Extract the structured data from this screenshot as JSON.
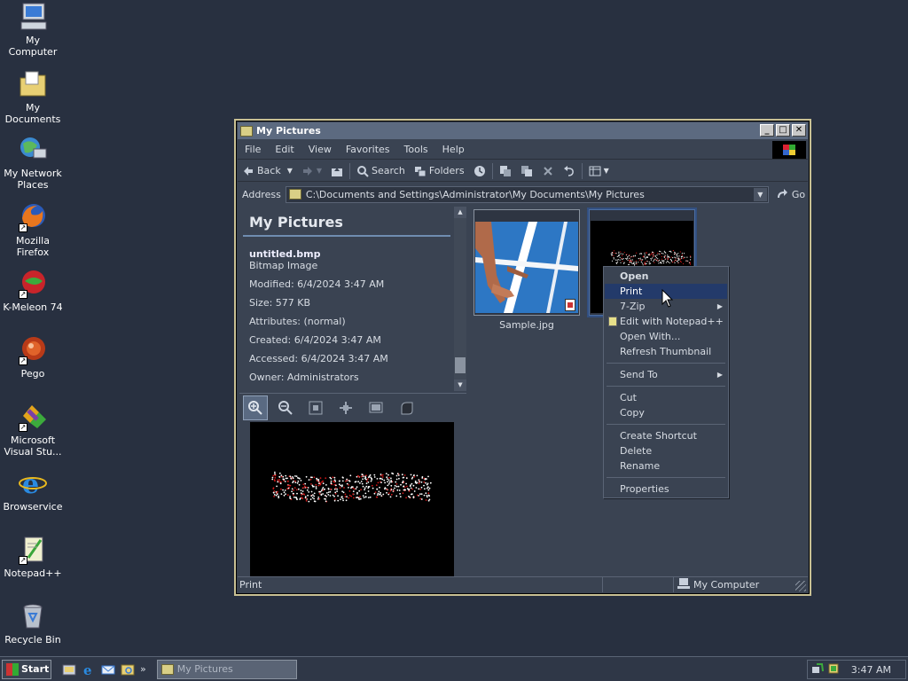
{
  "desktop": {
    "icons": [
      {
        "label": "My Computer",
        "icon": "my-computer-icon"
      },
      {
        "label": "My Documents",
        "icon": "my-documents-icon"
      },
      {
        "label": "My Network Places",
        "icon": "network-places-icon"
      },
      {
        "label": "Mozilla Firefox",
        "icon": "firefox-icon"
      },
      {
        "label": "K-Meleon 74",
        "icon": "kmeleon-icon"
      },
      {
        "label": "Pego",
        "icon": "pego-icon"
      },
      {
        "label": "Microsoft Visual Stu...",
        "icon": "visual-studio-icon"
      },
      {
        "label": "Browservice",
        "icon": "internet-explorer-icon"
      },
      {
        "label": "Notepad++",
        "icon": "notepadpp-icon"
      },
      {
        "label": "Recycle Bin",
        "icon": "recycle-bin-icon"
      }
    ]
  },
  "window": {
    "title": "My Pictures",
    "controls": {
      "minimize": "_",
      "maximize": "□",
      "close": "✕"
    },
    "menu": [
      "File",
      "Edit",
      "View",
      "Favorites",
      "Tools",
      "Help"
    ],
    "toolbar": {
      "back": "Back",
      "search": "Search",
      "folders": "Folders"
    },
    "address": {
      "label": "Address",
      "value": "C:\\Documents and Settings\\Administrator\\My Documents\\My Pictures",
      "go": "Go"
    },
    "details": {
      "heading": "My Pictures",
      "file_name": "untitled.bmp",
      "file_type": "Bitmap Image",
      "modified": "Modified: 6/4/2024 3:47 AM",
      "size": "Size: 577 KB",
      "attributes": "Attributes: (normal)",
      "created": "Created: 6/4/2024 3:47 AM",
      "accessed": "Accessed: 6/4/2024 3:47 AM",
      "owner": "Owner: Administrators"
    },
    "files": [
      {
        "name": "Sample.jpg"
      },
      {
        "name": "untitled.bmp"
      }
    ],
    "status": {
      "text": "Print",
      "zone": "My Computer"
    }
  },
  "context_menu": {
    "items": [
      {
        "label": "Open",
        "bold": true
      },
      {
        "label": "Print",
        "highlighted": true
      },
      {
        "label": "7-Zip",
        "submenu": true
      },
      {
        "label": "Edit with Notepad++"
      },
      {
        "label": "Open With..."
      },
      {
        "label": "Refresh Thumbnail"
      },
      {
        "label": "Send To",
        "submenu": true
      },
      {
        "label": "Cut"
      },
      {
        "label": "Copy"
      },
      {
        "label": "Create Shortcut"
      },
      {
        "label": "Delete"
      },
      {
        "label": "Rename"
      },
      {
        "label": "Properties"
      }
    ]
  },
  "taskbar": {
    "start": "Start",
    "task": "My Pictures",
    "clock": "3:47 AM"
  },
  "colors": {
    "desktop": "#283040",
    "highlight": "#233a6a",
    "window_border": "#c9c093"
  }
}
